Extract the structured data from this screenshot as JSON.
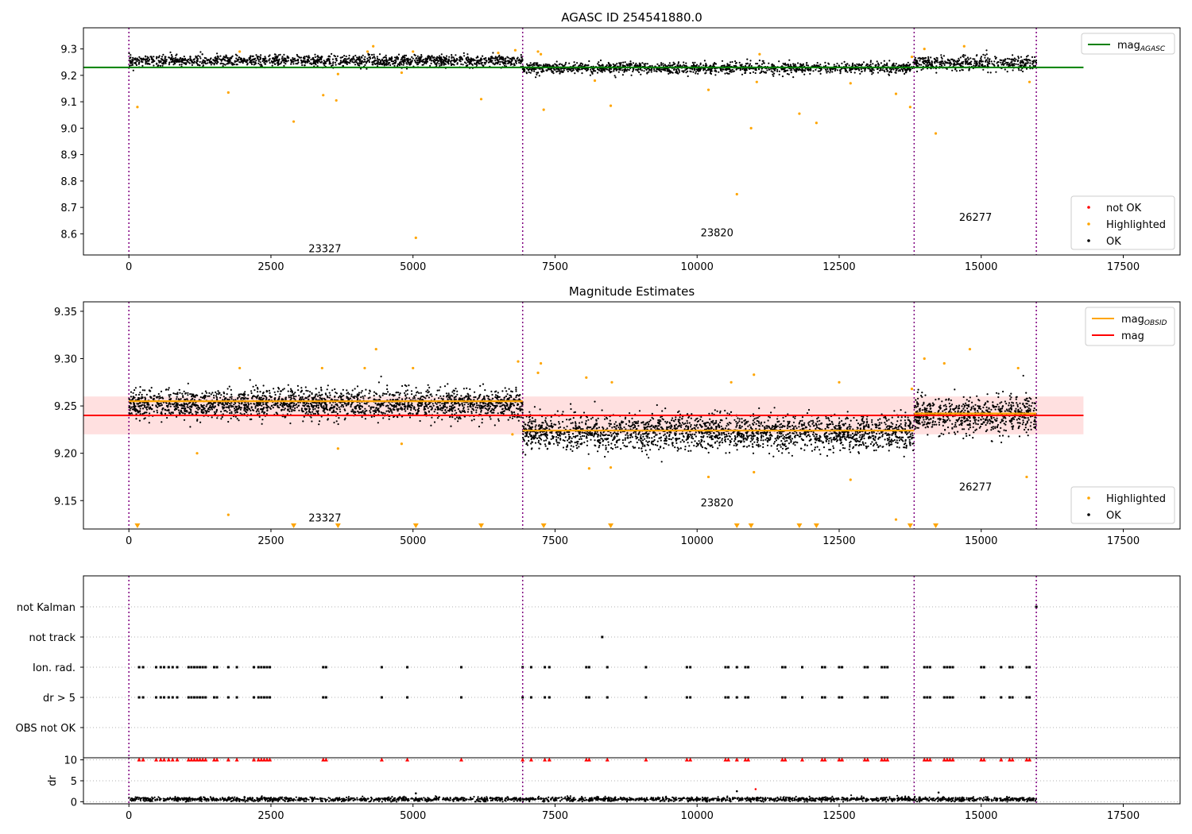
{
  "chart_data": [
    {
      "type": "scatter",
      "title": "AGASC ID 254541880.0",
      "xlim": [
        -800,
        18500
      ],
      "ylim": [
        8.52,
        9.38
      ],
      "xticks": [
        0,
        2500,
        5000,
        7500,
        10000,
        12500,
        15000,
        17500
      ],
      "yticks": [
        8.6,
        8.7,
        8.8,
        8.9,
        9.0,
        9.1,
        9.2,
        9.3
      ],
      "legend": {
        "top": {
          "position": "top-right",
          "entries": [
            {
              "label": "mag",
              "sub": "AGASC",
              "color": "#008000"
            }
          ]
        },
        "bottom": {
          "position": "bottom-right",
          "entries": [
            {
              "label": "not OK",
              "color": "#ff0000"
            },
            {
              "label": "Highlighted",
              "color": "#ffa500"
            },
            {
              "label": "OK",
              "color": "#000000"
            }
          ]
        }
      },
      "agasc_mag": 9.23,
      "agasc_xrange": [
        -800,
        16800
      ],
      "obs_boundaries": [
        0,
        6930,
        13820,
        15970
      ],
      "obs_labels": [
        {
          "text": "23327",
          "x": 3450,
          "y": 8.545
        },
        {
          "text": "23820",
          "x": 10350,
          "y": 8.605
        },
        {
          "text": "26277",
          "x": 14900,
          "y": 8.665
        }
      ],
      "ok_segments": [
        {
          "x0": 0,
          "x1": 6930,
          "mean": 9.255,
          "spread": 0.015
        },
        {
          "x0": 6930,
          "x1": 13820,
          "mean": 9.228,
          "spread": 0.015
        },
        {
          "x0": 13820,
          "x1": 15970,
          "mean": 9.245,
          "spread": 0.02
        }
      ],
      "highlighted_points": [
        [
          150,
          9.08
        ],
        [
          1750,
          9.135
        ],
        [
          2900,
          9.025
        ],
        [
          3420,
          9.125
        ],
        [
          3650,
          9.105
        ],
        [
          3680,
          9.205
        ],
        [
          4800,
          9.21
        ],
        [
          5050,
          8.585
        ],
        [
          6200,
          9.11
        ],
        [
          7300,
          9.07
        ],
        [
          8200,
          9.18
        ],
        [
          8480,
          9.085
        ],
        [
          10200,
          9.145
        ],
        [
          10700,
          8.75
        ],
        [
          10950,
          9.0
        ],
        [
          11050,
          9.175
        ],
        [
          11800,
          9.055
        ],
        [
          12100,
          9.02
        ],
        [
          12700,
          9.17
        ],
        [
          13500,
          9.13
        ],
        [
          13750,
          9.08
        ],
        [
          14200,
          8.98
        ],
        [
          15850,
          9.175
        ],
        [
          4300,
          9.31
        ],
        [
          4200,
          9.29
        ],
        [
          5000,
          9.29
        ],
        [
          6800,
          9.295
        ],
        [
          7200,
          9.29
        ],
        [
          7250,
          9.28
        ],
        [
          1950,
          9.29
        ],
        [
          14000,
          9.3
        ],
        [
          14700,
          9.31
        ],
        [
          11100,
          9.28
        ],
        [
          13780,
          9.27
        ],
        [
          6500,
          9.285
        ]
      ]
    },
    {
      "type": "scatter",
      "title": "Magnitude Estimates",
      "xlim": [
        -800,
        18500
      ],
      "ylim": [
        9.12,
        9.36
      ],
      "xticks": [
        0,
        2500,
        5000,
        7500,
        10000,
        12500,
        15000,
        17500
      ],
      "yticks": [
        9.15,
        9.2,
        9.25,
        9.3,
        9.35
      ],
      "legend": {
        "top": {
          "position": "top-right",
          "entries": [
            {
              "label": "mag",
              "sub": "OBSID",
              "color": "#ffa500"
            },
            {
              "label": "mag",
              "sub": "",
              "color": "#ff0000"
            }
          ]
        },
        "bottom": {
          "position": "bottom-right",
          "entries": [
            {
              "label": "Highlighted",
              "color": "#ffa500"
            },
            {
              "label": "OK",
              "color": "#000000"
            }
          ]
        }
      },
      "mag": 9.24,
      "mag_band": [
        9.22,
        9.26
      ],
      "mag_xrange": [
        -800,
        16800
      ],
      "obsid_mags": [
        {
          "x0": 0,
          "x1": 6930,
          "value": 9.255
        },
        {
          "x0": 6930,
          "x1": 13820,
          "value": 9.224
        },
        {
          "x0": 13820,
          "x1": 15970,
          "value": 9.242
        }
      ],
      "obs_boundaries": [
        0,
        6930,
        13820,
        15970
      ],
      "obs_labels": [
        {
          "text": "23327",
          "x": 3450,
          "y": 9.132
        },
        {
          "text": "23820",
          "x": 10350,
          "y": 9.148
        },
        {
          "text": "26277",
          "x": 14900,
          "y": 9.165
        }
      ],
      "ok_segments": [
        {
          "x0": 0,
          "x1": 6930,
          "mean": 9.252,
          "spread": 0.011
        },
        {
          "x0": 6930,
          "x1": 13820,
          "mean": 9.222,
          "spread": 0.013
        },
        {
          "x0": 13820,
          "x1": 15970,
          "mean": 9.24,
          "spread": 0.014
        }
      ],
      "highlighted_points": [
        [
          1750,
          9.135
        ],
        [
          3680,
          9.205
        ],
        [
          4800,
          9.21
        ],
        [
          6750,
          9.22
        ],
        [
          8100,
          9.184
        ],
        [
          8480,
          9.185
        ],
        [
          10200,
          9.175
        ],
        [
          11000,
          9.18
        ],
        [
          12700,
          9.172
        ],
        [
          13500,
          9.13
        ],
        [
          15800,
          9.175
        ],
        [
          1200,
          9.2
        ],
        [
          4350,
          9.31
        ],
        [
          4150,
          9.29
        ],
        [
          1950,
          9.29
        ],
        [
          3400,
          9.29
        ],
        [
          5000,
          9.29
        ],
        [
          6850,
          9.297
        ],
        [
          7250,
          9.295
        ],
        [
          7200,
          9.285
        ],
        [
          8050,
          9.28
        ],
        [
          8500,
          9.275
        ],
        [
          10600,
          9.275
        ],
        [
          11000,
          9.283
        ],
        [
          14000,
          9.3
        ],
        [
          14350,
          9.295
        ],
        [
          14800,
          9.31
        ],
        [
          15650,
          9.29
        ],
        [
          13780,
          9.268
        ],
        [
          12500,
          9.275
        ]
      ],
      "offscale_markers": [
        150,
        2900,
        3680,
        5050,
        6200,
        7300,
        8480,
        10700,
        10950,
        11800,
        12100,
        13750,
        14200
      ]
    },
    {
      "type": "scatter",
      "title": "",
      "xlim": [
        -800,
        18500
      ],
      "categories": [
        "not Kalman",
        "not track",
        "Ion. rad.",
        "dr > 5",
        "OBS not OK"
      ],
      "obs_boundaries": [
        0,
        6930,
        13820,
        15970
      ],
      "flag_points": {
        "not Kalman": [
          15970
        ],
        "not track": [
          8330
        ],
        "Ion. rad.": [
          180,
          250,
          480,
          560,
          620,
          700,
          770,
          850,
          1050,
          1100,
          1150,
          1200,
          1250,
          1300,
          1350,
          1500,
          1550,
          1750,
          1900,
          2200,
          2280,
          2330,
          2380,
          2430,
          2480,
          3420,
          3470,
          4450,
          4900,
          5850,
          6930,
          7080,
          7320,
          7400,
          8050,
          8100,
          8420,
          9100,
          9820,
          9880,
          10500,
          10550,
          10700,
          10850,
          10900,
          11500,
          11550,
          11850,
          12200,
          12250,
          12500,
          12550,
          12950,
          13000,
          13250,
          13300,
          13350,
          14000,
          14050,
          14100,
          14350,
          14400,
          14450,
          14500,
          15000,
          15050,
          15350,
          15500,
          15550,
          15800,
          15850
        ],
        "dr > 5": [
          180,
          250,
          480,
          560,
          620,
          700,
          770,
          850,
          1050,
          1100,
          1150,
          1200,
          1250,
          1300,
          1350,
          1500,
          1550,
          1750,
          1900,
          2200,
          2280,
          2330,
          2380,
          2430,
          2480,
          3420,
          3470,
          4450,
          4900,
          5850,
          6930,
          7080,
          7320,
          7400,
          8050,
          8100,
          8420,
          9100,
          9820,
          9880,
          10500,
          10550,
          10700,
          10850,
          10900,
          11500,
          11550,
          11850,
          12200,
          12250,
          12500,
          12550,
          12950,
          13000,
          13250,
          13300,
          13350,
          14000,
          14050,
          14100,
          14350,
          14400,
          14450,
          14500,
          15000,
          15050,
          15350,
          15500,
          15550,
          15800,
          15850
        ],
        "OBS not OK": []
      }
    },
    {
      "type": "scatter",
      "title": "",
      "xlim": [
        -800,
        18500
      ],
      "ylim": [
        -0.5,
        10.5
      ],
      "ylabel": "dr",
      "yticks": [
        0,
        5,
        10
      ],
      "xticks": [
        0,
        2500,
        5000,
        7500,
        10000,
        12500,
        15000,
        17500
      ],
      "obs_boundaries": [
        0,
        6930,
        13820,
        15970
      ],
      "dr_baseline": 0.6,
      "dr_clipped_x": [
        180,
        250,
        480,
        560,
        620,
        700,
        770,
        850,
        1050,
        1100,
        1150,
        1200,
        1250,
        1300,
        1350,
        1500,
        1550,
        1750,
        1900,
        2200,
        2280,
        2330,
        2380,
        2430,
        2480,
        3420,
        3470,
        4450,
        4900,
        5850,
        6930,
        7080,
        7320,
        7400,
        8050,
        8100,
        8420,
        9100,
        9820,
        9880,
        10500,
        10550,
        10700,
        10850,
        10900,
        11500,
        11550,
        11850,
        12200,
        12250,
        12500,
        12550,
        12950,
        13000,
        13250,
        13300,
        13350,
        14000,
        14050,
        14100,
        14350,
        14400,
        14450,
        14500,
        15000,
        15050,
        15350,
        15500,
        15550,
        15800,
        15850
      ],
      "dr_outliers": [
        [
          5050,
          2.0
        ],
        [
          10700,
          2.5
        ],
        [
          11030,
          3.0
        ],
        [
          14250,
          2.2
        ]
      ]
    }
  ]
}
